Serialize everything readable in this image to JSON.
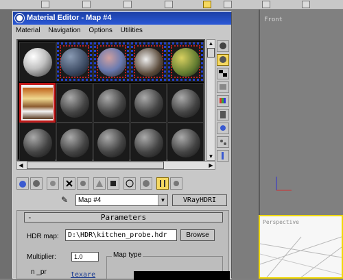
{
  "window": {
    "title": "Material Editor - Map #4",
    "menu": [
      "Material",
      "Navigation",
      "Options",
      "Utilities"
    ]
  },
  "viewports": {
    "front_label": "Front",
    "perspective_label": "Perspective"
  },
  "colors": {
    "titlebar": "#2a58d6",
    "selection_border": "#c01818",
    "active_button": "#f5d860",
    "viewport_highlight": "#f0d800"
  },
  "sample_slots": {
    "rows": 3,
    "cols": 5,
    "selected_index": 5
  },
  "map_name": "Map #4",
  "map_type_button": "VRayHDRI",
  "rollout": {
    "title": "Parameters",
    "collapse_symbol": "-",
    "hdr_map_label": "HDR map:",
    "hdr_map_value": "D:\\HDR\\kitchen_probe.hdr",
    "browse_label": "Browse",
    "multiplier_label": "Multiplier:",
    "multiplier_value": "1.0",
    "map_type_group": "Map type",
    "mirror_fragment": "n _pr",
    "texture_label": "texare"
  }
}
